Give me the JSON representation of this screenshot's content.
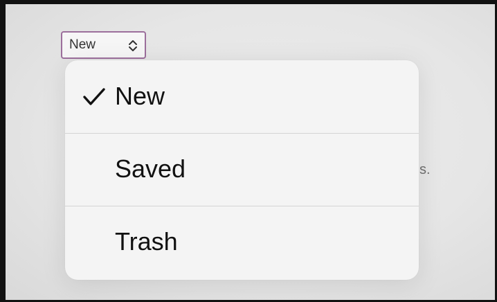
{
  "picker": {
    "selected_label": "New",
    "chevron_icon": "chevron-up-down-icon"
  },
  "background": {
    "partial_text": "s."
  },
  "menu": {
    "checkmark_icon": "checkmark-icon",
    "items": [
      {
        "label": "New",
        "checked": true
      },
      {
        "label": "Saved",
        "checked": false
      },
      {
        "label": "Trash",
        "checked": false
      }
    ]
  },
  "colors": {
    "picker_border": "#9c6f9c",
    "menu_background": "#f4f4f4",
    "page_background": "#e6e6e6"
  }
}
